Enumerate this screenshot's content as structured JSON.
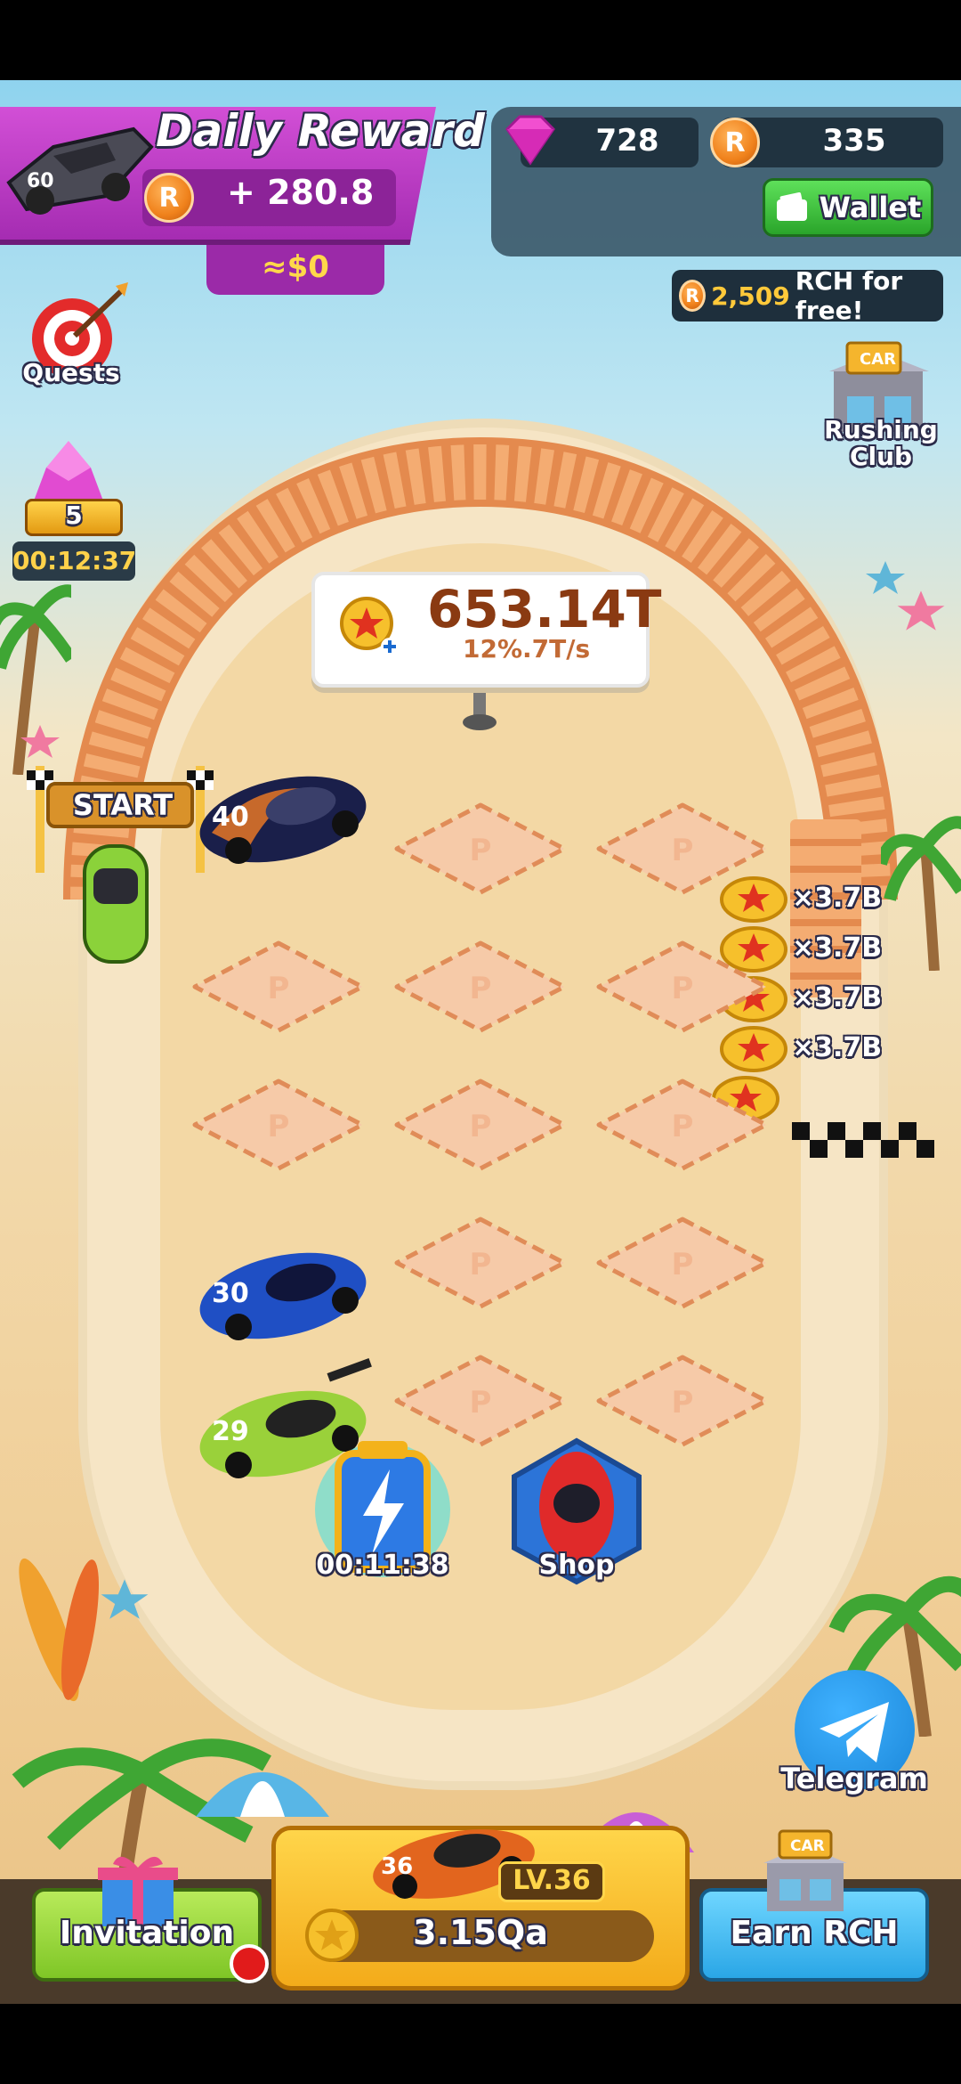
{
  "daily_reward": {
    "title": "Daily Reward",
    "amount": "+ 280.8",
    "usd": "≈$0",
    "car_number": "60"
  },
  "currency": {
    "gems": "728",
    "rch": "335",
    "wallet_label": "Wallet"
  },
  "promo": {
    "amount": "2,509",
    "text": "RCH for free!"
  },
  "left_menu": {
    "quests_label": "Quests",
    "chest_count": "5",
    "chest_timer": "00:12:37"
  },
  "right_menu": {
    "club_label_1": "Rushing",
    "club_label_2": "Club",
    "club_sign": "CAR"
  },
  "score": {
    "value": "653.14T",
    "rate": "12%.7T/s"
  },
  "start_label": "START",
  "parked_cars": [
    {
      "number": "40"
    },
    {
      "number": "30"
    },
    {
      "number": "29"
    }
  ],
  "multipliers": [
    "×3.7B",
    "×3.7B",
    "×3.7B",
    "×3.7B"
  ],
  "boost": {
    "timer": "00:11:38"
  },
  "shop": {
    "label": "Shop"
  },
  "telegram": {
    "label": "Telegram"
  },
  "bottom": {
    "invitation_label": "Invitation",
    "level": "LV.36",
    "car_number": "36",
    "price": "3.15Qa",
    "earn_label": "Earn RCH",
    "earn_sign": "CAR"
  },
  "colors": {
    "accent_purple": "#b43ab9",
    "wallet_green": "#3cc03a",
    "gold": "#ffc93a",
    "telegram": "#2196e8"
  }
}
